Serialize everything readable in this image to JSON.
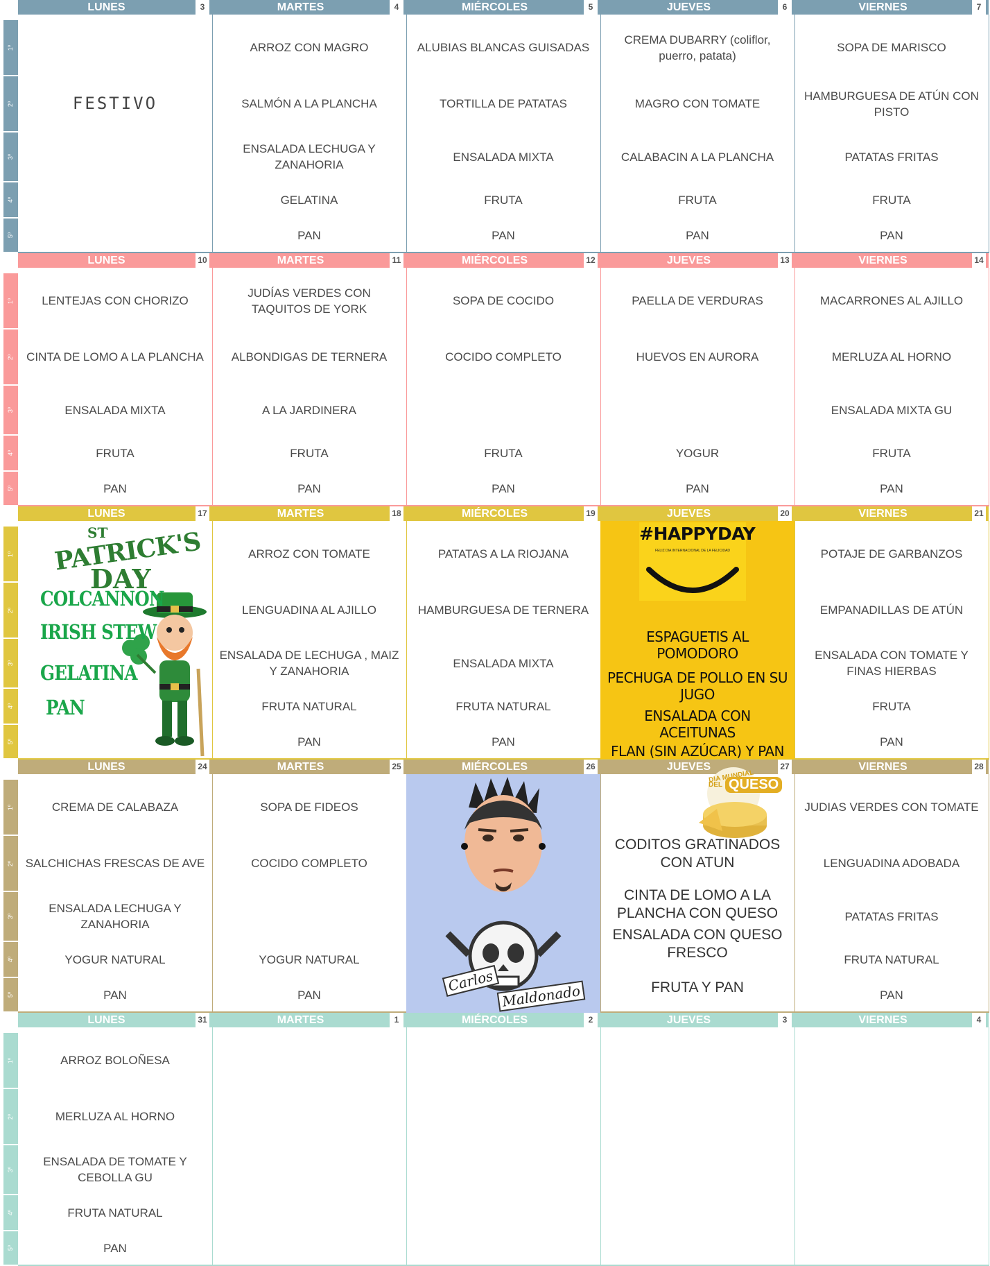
{
  "course_labels": [
    "1º",
    "2º",
    "3º",
    "4º",
    "5º"
  ],
  "days": [
    "LUNES",
    "MARTES",
    "MIÉRCOLES",
    "JUEVES",
    "VIERNES"
  ],
  "weeks": [
    {
      "color": "#7c9fb1",
      "numbers": [
        "3",
        "4",
        "5",
        "6",
        "7"
      ],
      "menus": [
        [
          "",
          "",
          "",
          "",
          ""
        ],
        [
          "ARROZ CON MAGRO",
          "SALMÓN A LA PLANCHA",
          "ENSALADA LECHUGA Y ZANAHORIA",
          "GELATINA",
          "PAN"
        ],
        [
          "ALUBIAS BLANCAS GUISADAS",
          "TORTILLA DE PATATAS",
          "ENSALADA MIXTA",
          "FRUTA",
          "PAN"
        ],
        [
          "CREMA DUBARRY (coliflor, puerro, patata)",
          "MAGRO CON TOMATE",
          "CALABACIN A LA PLANCHA",
          "FRUTA",
          "PAN"
        ],
        [
          "SOPA DE MARISCO",
          "HAMBURGUESA DE ATÚN CON PISTO",
          "PATATAS FRITAS",
          "FRUTA",
          "PAN"
        ]
      ]
    },
    {
      "color": "#fa9a9a",
      "numbers": [
        "10",
        "11",
        "12",
        "13",
        "14"
      ],
      "menus": [
        [
          "LENTEJAS CON CHORIZO",
          "CINTA DE LOMO A LA PLANCHA",
          "ENSALADA MIXTA",
          "FRUTA",
          "PAN"
        ],
        [
          "JUDÍAS VERDES CON TAQUITOS DE YORK",
          "ALBONDIGAS DE TERNERA",
          "A LA JARDINERA",
          "FRUTA",
          "PAN"
        ],
        [
          "SOPA DE COCIDO",
          "COCIDO COMPLETO",
          "",
          "FRUTA",
          "PAN"
        ],
        [
          "PAELLA DE VERDURAS",
          "HUEVOS EN AURORA",
          "",
          "YOGUR",
          "PAN"
        ],
        [
          "MACARRONES AL AJILLO",
          "MERLUZA AL HORNO",
          "ENSALADA MIXTA GU",
          "FRUTA",
          "PAN"
        ]
      ]
    },
    {
      "color": "#e0c640",
      "numbers": [
        "17",
        "18",
        "19",
        "20",
        "21"
      ],
      "menus": [
        [
          "",
          "",
          "",
          "",
          ""
        ],
        [
          "ARROZ CON TOMATE",
          "LENGUADINA AL AJILLO",
          "ENSALADA DE LECHUGA , MAIZ Y ZANAHORIA",
          "FRUTA NATURAL",
          "PAN"
        ],
        [
          "PATATAS A LA RIOJANA",
          "HAMBURGUESA DE TERNERA",
          "ENSALADA MIXTA",
          "FRUTA NATURAL",
          "PAN"
        ],
        [
          "",
          "",
          "",
          "",
          ""
        ],
        [
          "POTAJE DE GARBANZOS",
          "EMPANADILLAS DE ATÚN",
          "ENSALADA CON TOMATE Y FINAS HIERBAS",
          "FRUTA",
          "PAN"
        ]
      ]
    },
    {
      "color": "#bfac7a",
      "numbers": [
        "24",
        "25",
        "26",
        "27",
        "28"
      ],
      "menus": [
        [
          "CREMA DE CALABAZA",
          "SALCHICHAS FRESCAS DE AVE",
          "ENSALADA LECHUGA Y ZANAHORIA",
          "YOGUR NATURAL",
          "PAN"
        ],
        [
          "SOPA DE FIDEOS",
          "COCIDO COMPLETO",
          "",
          "YOGUR NATURAL",
          "PAN"
        ],
        [
          "",
          "",
          "",
          "",
          ""
        ],
        [
          "",
          "",
          "",
          "",
          ""
        ],
        [
          "JUDIAS VERDES CON TOMATE",
          "LENGUADINA ADOBADA",
          "PATATAS FRITAS",
          "FRUTA NATURAL",
          "PAN"
        ]
      ]
    },
    {
      "color": "#aadbd0",
      "numbers": [
        "31",
        "1",
        "2",
        "3",
        "4"
      ],
      "menus": [
        [
          "ARROZ BOLOÑESA",
          "MERLUZA AL HORNO",
          "ENSALADA DE TOMATE Y CEBOLLA GU",
          "FRUTA NATURAL",
          "PAN"
        ],
        [
          "",
          "",
          "",
          "",
          ""
        ],
        [
          "",
          "",
          "",
          "",
          ""
        ],
        [
          "",
          "",
          "",
          "",
          ""
        ],
        [
          "",
          "",
          "",
          "",
          ""
        ]
      ]
    }
  ],
  "festivo": "FESTIVO",
  "stpatricks": {
    "logo_top": "ST",
    "logo_mid": "PATRICK'S",
    "logo_bot": "DAY",
    "items": [
      "COLCANNON",
      "IRISH STEW",
      "GELATINA",
      "PAN"
    ]
  },
  "happyday": {
    "title": "#HAPPYDAY",
    "subtitle": "FELIZ DIA INTERNACIONAL DE LA FELICIDAD",
    "items": [
      "ESPAGUETIS AL POMODORO",
      "PECHUGA DE POLLO EN SU JUGO",
      "ENSALADA CON ACEITUNAS",
      "FLAN (SIN AZÚCAR) Y PAN"
    ]
  },
  "queso": {
    "badge_top": "DIA MUNDIAL",
    "badge_mid": "DEL",
    "badge_bot": "QUESO",
    "items": [
      "CODITOS GRATINADOS CON ATUN",
      "CINTA DE LOMO A LA PLANCHA CON QUESO",
      "ENSALADA CON QUESO FRESCO",
      "FRUTA Y PAN"
    ]
  },
  "chef": {
    "line1": "Carlos",
    "line2": "Maldonado"
  }
}
